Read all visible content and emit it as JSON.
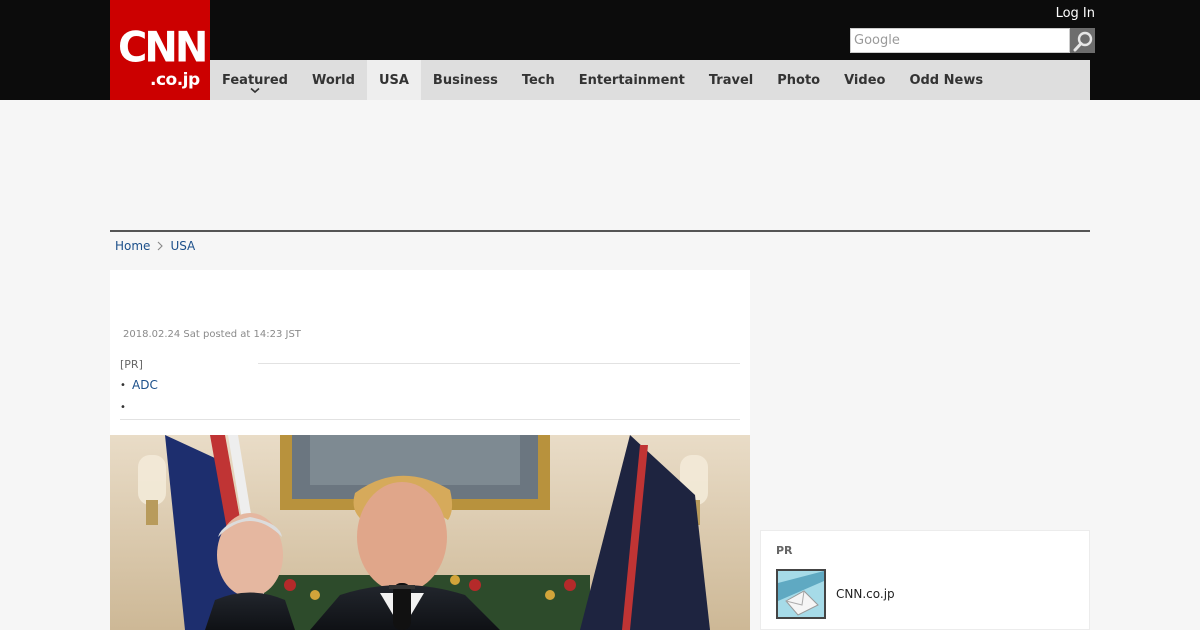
{
  "header": {
    "logo": {
      "main": "CNN",
      "tld": ".co.jp"
    },
    "login_label": "Log In",
    "search": {
      "placeholder": "Google",
      "button_icon": "search-icon"
    }
  },
  "nav": {
    "items": [
      {
        "label": "Featured",
        "has_dropdown": true
      },
      {
        "label": "World"
      },
      {
        "label": "USA",
        "active": true
      },
      {
        "label": "Business"
      },
      {
        "label": "Tech"
      },
      {
        "label": "Entertainment"
      },
      {
        "label": "Travel"
      },
      {
        "label": "Photo"
      },
      {
        "label": "Video"
      },
      {
        "label": "Odd News"
      }
    ]
  },
  "breadcrumb": [
    {
      "label": "Home"
    },
    {
      "label": "USA"
    }
  ],
  "article": {
    "posted": "2018.02.24 Sat posted at 14:23 JST",
    "pr_label": "[PR]",
    "pr_links": [
      "ADC",
      ""
    ]
  },
  "sidebar": {
    "pr_title": "PR",
    "pr_item": "CNN.co.jp"
  },
  "colors": {
    "brand_red": "#cc0000",
    "topbar": "#0c0c0c",
    "nav_bg": "#dedede",
    "link": "#1b4f8a"
  }
}
